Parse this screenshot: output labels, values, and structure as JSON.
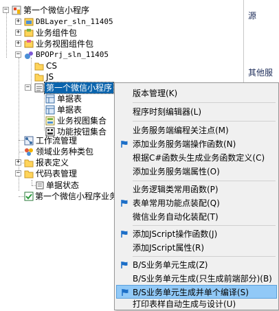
{
  "right_panel": {
    "label_top": "源",
    "label_mid": "其他服"
  },
  "tree": {
    "root": "第一个微信小程序",
    "n_dblayer": "DBLayer_sln_11405",
    "n_biz_components": "业务组件包",
    "n_biz_views": "业务视图组件包",
    "n_bpo": "BPOPrj_sln_11405",
    "n_cs": "CS",
    "n_js": "JS",
    "n_selected": "第一个微信小程序",
    "n_bill1": "单据表",
    "n_bill2": "单据表",
    "n_view_set": "业务视图集合",
    "n_func_set": "功能按钮集合",
    "n_workflow": "工作流管理",
    "n_domain": "领域业务种类包",
    "n_report": "报表定义",
    "n_codetable": "代码表管理",
    "n_bill_status": "单据状态",
    "n_last": "第一个微信小程序业务"
  },
  "context_menu": {
    "items": [
      {
        "label": "版本管理(K)",
        "flag": false
      },
      {
        "label": "程序时刻编辑器(L)",
        "flag": false
      },
      {
        "label": "业务服务端编程关注点(M)",
        "flag": false
      },
      {
        "label": "添加业务服务端操作函数(N)",
        "flag": true
      },
      {
        "label": "根据C#函数头生成业务函数定义(C)",
        "flag": false
      },
      {
        "label": "添加业务服务端属性(O)",
        "flag": false
      },
      {
        "label": "业务逻辑类常用函数(P)",
        "flag": false
      },
      {
        "label": "表单常用功能点装配(Q)",
        "flag": true
      },
      {
        "label": "微信业务自动化装配(T)",
        "flag": false
      },
      {
        "label": "添加JScript操作函数(J)",
        "flag": true
      },
      {
        "label": "添加JScript属性(R)",
        "flag": false
      },
      {
        "label": "B/S业务单元生成(Z)",
        "flag": true
      },
      {
        "label": "B/S业务单元生成(只生成前端部分)(B)",
        "flag": false
      },
      {
        "label": "B/S业务单元生成并单个编译(S)",
        "flag": true
      },
      {
        "label": "打印表样自动生成与设计(U)",
        "flag": false
      }
    ],
    "colors": {
      "hover_bg": "#91c9f7",
      "flag": "#1c6fc8",
      "selected_bg": "#0a64ad"
    }
  }
}
